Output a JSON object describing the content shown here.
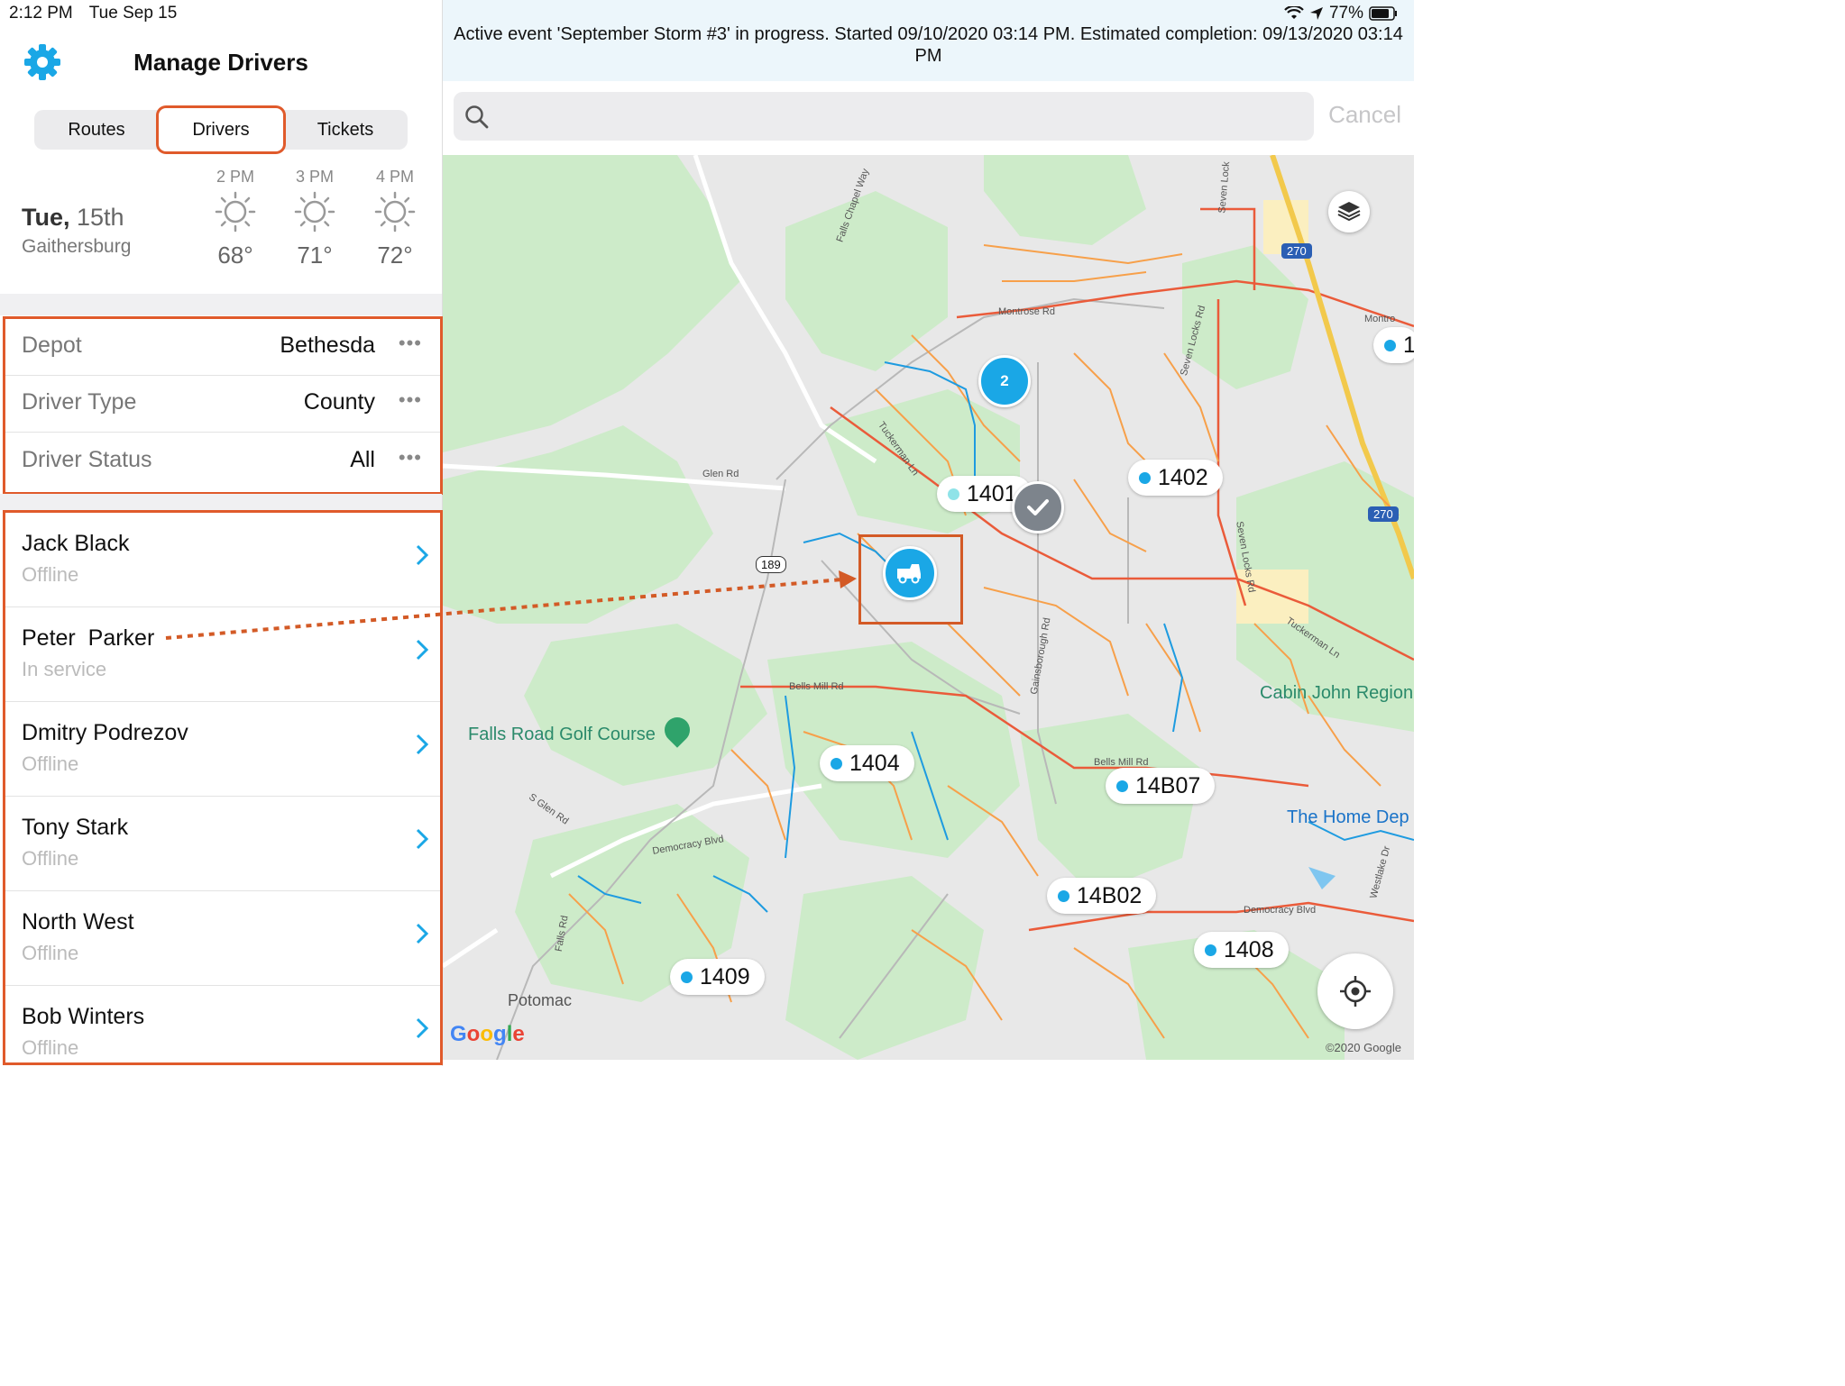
{
  "status": {
    "time": "2:12 PM",
    "date": "Tue Sep 15",
    "battery": "77%"
  },
  "header": {
    "title": "Manage Drivers",
    "icon": "gear-icon"
  },
  "tabs": [
    {
      "label": "Routes",
      "active": false
    },
    {
      "label": "Drivers",
      "active": true
    },
    {
      "label": "Tickets",
      "active": false
    }
  ],
  "weather": {
    "day": "Tue,",
    "date": "15th",
    "city": "Gaithersburg",
    "hours": [
      {
        "time": "2 PM",
        "temp": "68°",
        "icon": "sun-icon"
      },
      {
        "time": "3 PM",
        "temp": "71°",
        "icon": "sun-icon"
      },
      {
        "time": "4 PM",
        "temp": "72°",
        "icon": "sun-icon"
      }
    ]
  },
  "filters": [
    {
      "label": "Depot",
      "value": "Bethesda",
      "more": "•••"
    },
    {
      "label": "Driver Type",
      "value": "County",
      "more": "•••"
    },
    {
      "label": "Driver Status",
      "value": "All",
      "more": "•••"
    }
  ],
  "drivers": [
    {
      "name": "Jack Black",
      "status": "Offline"
    },
    {
      "name": "Peter  Parker",
      "status": "In service"
    },
    {
      "name": "Dmitry Podrezov",
      "status": "Offline"
    },
    {
      "name": "Tony Stark",
      "status": "Offline"
    },
    {
      "name": "North West",
      "status": "Offline"
    },
    {
      "name": "Bob Winters",
      "status": "Offline"
    }
  ],
  "banner": {
    "text": "Active event 'September Storm #3' in progress. Started 09/10/2020 03:14 PM. Estimated completion: 09/13/2020 03:14 PM"
  },
  "search": {
    "placeholder": "",
    "cancel": "Cancel"
  },
  "map": {
    "markers": [
      "1401",
      "1402",
      "1404",
      "14B07",
      "14B02",
      "1408",
      "1409"
    ],
    "cluster": "2",
    "cutoff_marker": "1",
    "roads": [
      "Montrose Rd",
      "Montro",
      "Glen Rd",
      "Tuckerman Ln",
      "Tuckerman Ln",
      "Bells Mill Rd",
      "Bells Mill Rd",
      "Democracy Blvd",
      "Democracy Blvd",
      "S Glen Rd",
      "Falls Rd",
      "Falls Chapel Way",
      "Seven Locks Rd",
      "Seven Locks Rd",
      "Seven Lock",
      "Gainsborough Rd",
      "Westlake Dr"
    ],
    "shields": [
      "189",
      "270",
      "270"
    ],
    "pois": {
      "golf": "Falls Road Golf Course",
      "cabin": "Cabin John Region",
      "homedepot": "The Home Dep",
      "potomac": "Potomac"
    },
    "brand": "Google",
    "copyright": "©2020 Google"
  },
  "colors": {
    "accent": "#1aa7e6",
    "highlight": "#d35a26",
    "roads_local": "#f7a04a",
    "roads_major": "#ea5b3a",
    "park": "#cdebc9",
    "water": "#1e9be0"
  }
}
